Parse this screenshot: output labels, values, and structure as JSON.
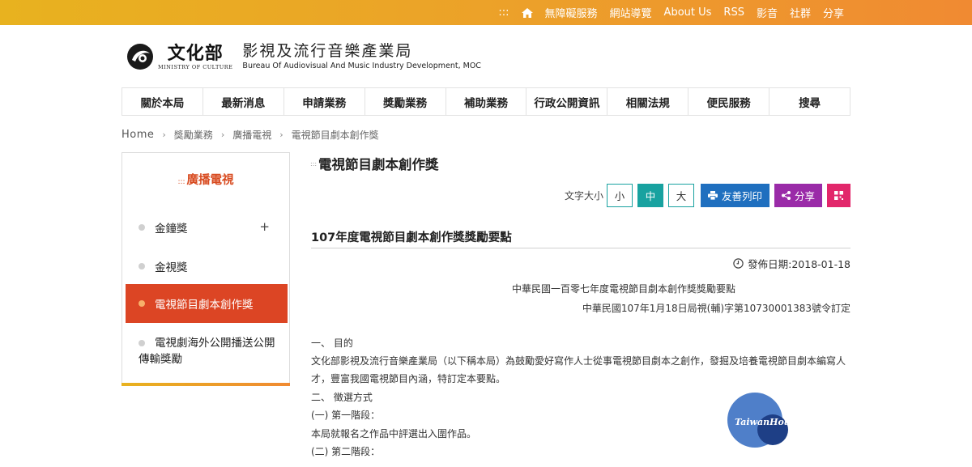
{
  "topbar": {
    "menu_glyph": ":::",
    "links": [
      "無障礙服務",
      "網站導覽",
      "About Us",
      "RSS",
      "影音",
      "社群",
      "分享"
    ]
  },
  "logo": {
    "moc_zh": "文化部",
    "moc_en": "MINISTRY OF CULTURE",
    "bureau_zh": "影視及流行音樂產業局",
    "bureau_en": "Bureau Of Audiovisual And Music Industry Development, MOC"
  },
  "nav": {
    "items": [
      "關於本局",
      "最新消息",
      "申請業務",
      "獎勵業務",
      "補助業務",
      "行政公開資訊",
      "相關法規",
      "便民服務",
      "搜尋"
    ]
  },
  "breadcrumb": {
    "home": "Home",
    "items": [
      "獎勵業務",
      "廣播電視",
      "電視節目劇本創作獎"
    ]
  },
  "sidebar": {
    "title_prefix": ":::",
    "title": "廣播電視",
    "items": [
      {
        "label": "金鐘獎",
        "expand": "+"
      },
      {
        "label": "金視獎"
      },
      {
        "label": "電視節目劇本創作獎"
      },
      {
        "label_line1": "電視劇海外公開播送公開",
        "label_line2": "傳輸獎勵"
      }
    ]
  },
  "content": {
    "title_prefix": ":::",
    "title": "電視節目劇本創作獎",
    "toolbar": {
      "font_size_label": "文字大小",
      "size_small": "小",
      "size_medium": "中",
      "size_large": "大",
      "print": "友善列印",
      "share": "分享"
    },
    "article_title": "107年度電視節目劇本創作獎獎勵要點",
    "pubdate": "發佈日期:2018-01-18",
    "doc_heading": "中華民國一百零七年度電視節目劇本創作獎獎勵要點",
    "doc_decree": "中華民國107年1月18日局視(輔)字第10730001383號令訂定",
    "paragraphs": [
      "一、  目的",
      "文化部影視及流行音樂產業局（以下稱本局）為鼓勵愛好寫作人士從事電視節目劇本之創作，發掘及培養電視節目劇本編寫人",
      "才，豐富我國電視節目內涵，特訂定本要點。",
      "二、  徵選方式",
      "(一)    第一階段：",
      "本局就報名之作品中評選出入圍作品。",
      "(二)    第二階段："
    ]
  },
  "watermark": {
    "text": "TaiwanHot"
  },
  "colors": {
    "topbar_start": "#e8b21f",
    "topbar_end": "#f08a32",
    "accent": "#dc4524",
    "teal": "#18a2a0",
    "print_blue": "#1f6fbf",
    "share_purple": "#9a2ba8",
    "qr_pink": "#e2276b"
  }
}
